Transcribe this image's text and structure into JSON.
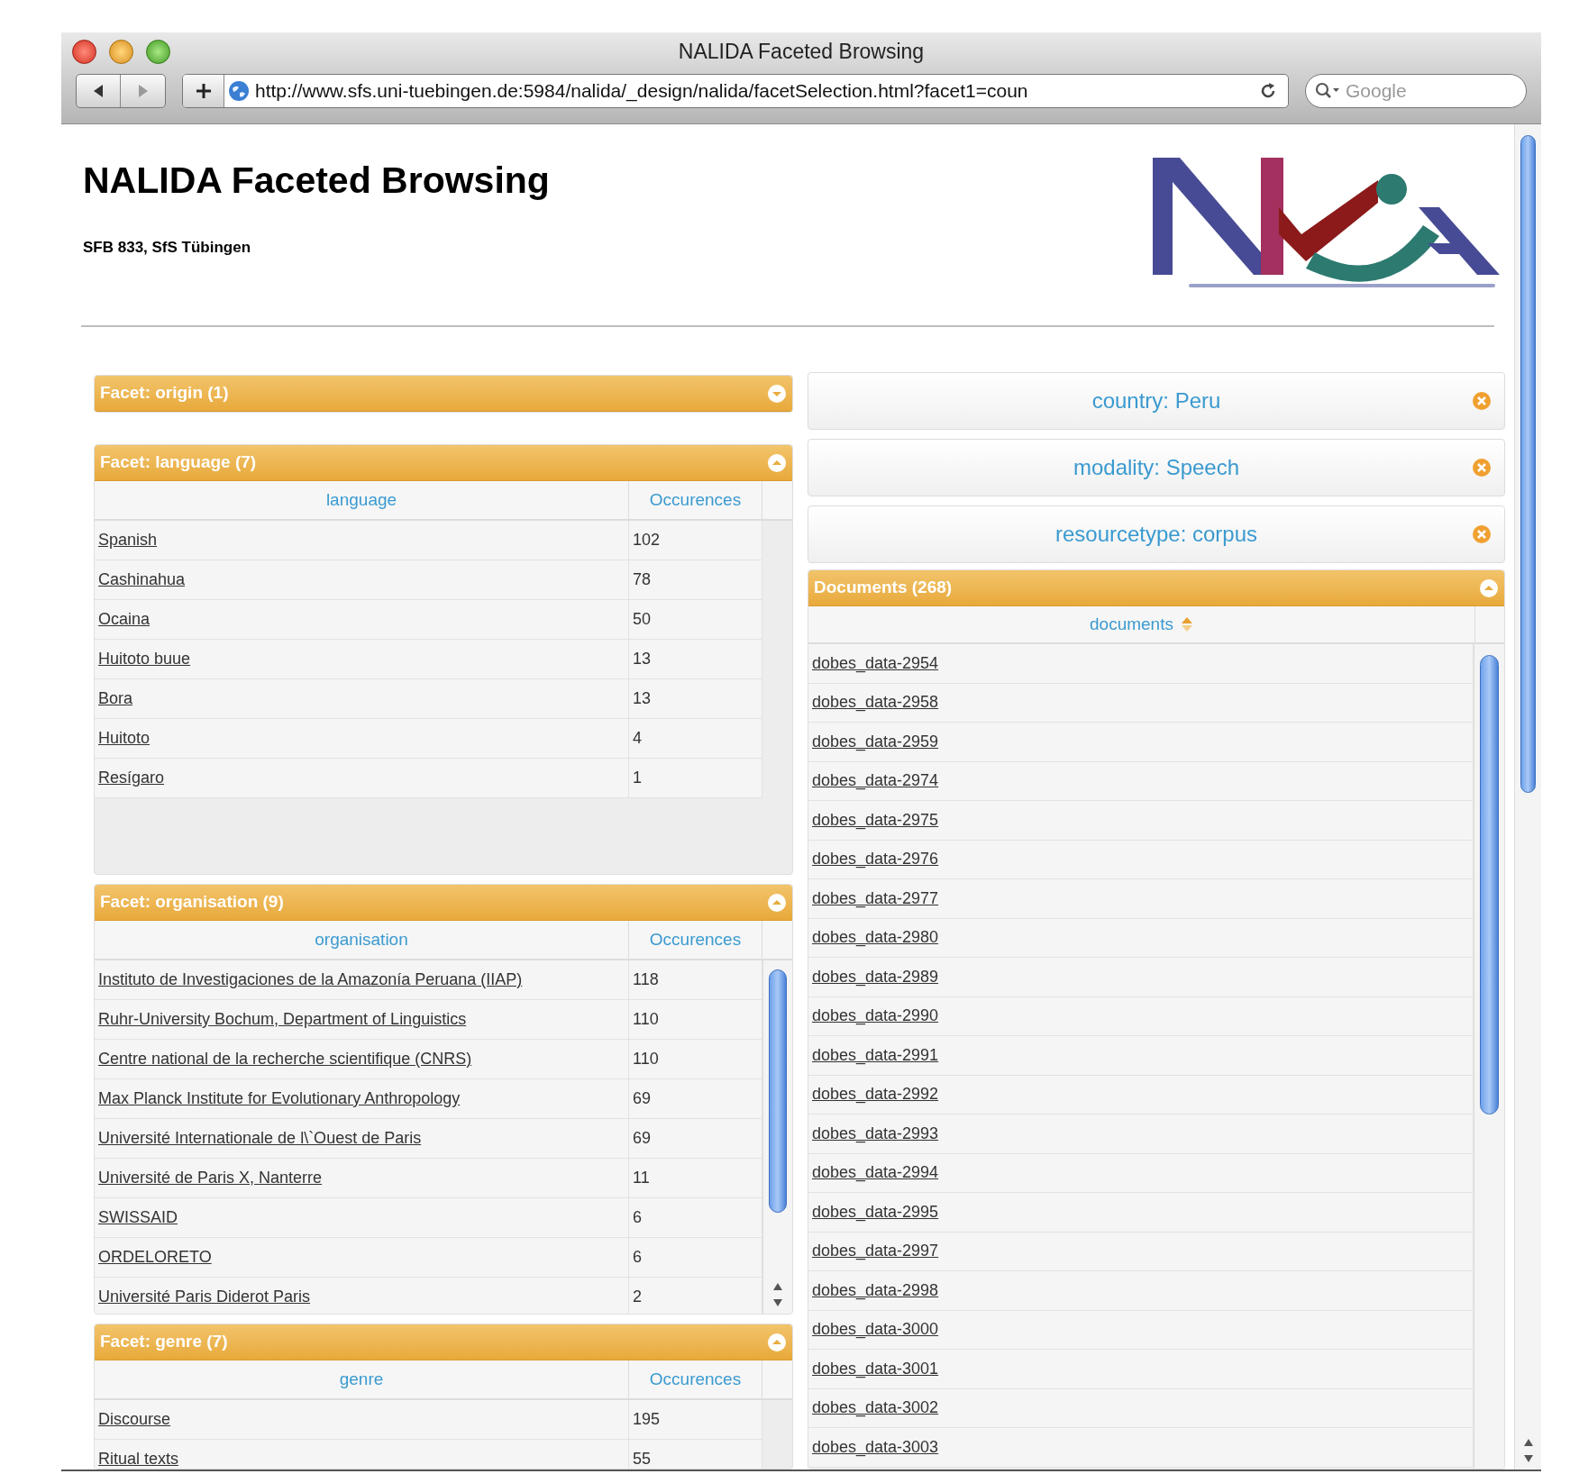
{
  "window": {
    "title": "NALIDA Faceted Browsing",
    "url": "http://www.sfs.uni-tuebingen.de:5984/nalida/_design/nalida/facetSelection.html?facet1=coun",
    "search_placeholder": "Google"
  },
  "page": {
    "title": "NALIDA Faceted Browsing",
    "subtitle": "SFB 833, SfS Tübingen"
  },
  "facets": [
    {
      "title": "Facet: origin (1)",
      "expanded": false
    },
    {
      "title": "Facet: language (7)",
      "expanded": true,
      "column": "language",
      "count_column": "Occurences",
      "rows": [
        {
          "label": "Spanish",
          "count": "102"
        },
        {
          "label": "Cashinahua",
          "count": "78"
        },
        {
          "label": "Ocaina",
          "count": "50"
        },
        {
          "label": "Huitoto buue",
          "count": "13"
        },
        {
          "label": "Bora",
          "count": "13"
        },
        {
          "label": "Huitoto",
          "count": "4"
        },
        {
          "label": "Resígaro",
          "count": "1"
        }
      ]
    },
    {
      "title": "Facet: organisation (9)",
      "expanded": true,
      "column": "organisation",
      "count_column": "Occurences",
      "rows": [
        {
          "label": "Instituto de Investigaciones de la Amazonía Peruana (IIAP)",
          "count": "118"
        },
        {
          "label": "Ruhr-University Bochum, Department of Linguistics",
          "count": "110"
        },
        {
          "label": "Centre national de la recherche scientifique (CNRS)",
          "count": "110"
        },
        {
          "label": "Max Planck Institute for Evolutionary Anthropology",
          "count": "69"
        },
        {
          "label": "Université Internationale de l\\`Ouest de Paris",
          "count": "69"
        },
        {
          "label": "Université de Paris X, Nanterre",
          "count": "11"
        },
        {
          "label": "SWISSAID",
          "count": "6"
        },
        {
          "label": "ORDELORETO",
          "count": "6"
        },
        {
          "label": "Université Paris Diderot Paris",
          "count": "2"
        }
      ]
    },
    {
      "title": "Facet: genre (7)",
      "expanded": true,
      "column": "genre",
      "count_column": "Occurences",
      "rows": [
        {
          "label": "Discourse",
          "count": "195"
        },
        {
          "label": "Ritual texts",
          "count": "55"
        }
      ]
    }
  ],
  "filters": [
    {
      "label": "country: Peru"
    },
    {
      "label": "modality: Speech"
    },
    {
      "label": "resourcetype: corpus"
    }
  ],
  "documents": {
    "title": "Documents (268)",
    "expanded": true,
    "column": "documents",
    "rows": [
      "dobes_data-2954",
      "dobes_data-2958",
      "dobes_data-2959",
      "dobes_data-2974",
      "dobes_data-2975",
      "dobes_data-2976",
      "dobes_data-2977",
      "dobes_data-2980",
      "dobes_data-2989",
      "dobes_data-2990",
      "dobes_data-2991",
      "dobes_data-2992",
      "dobes_data-2993",
      "dobes_data-2994",
      "dobes_data-2995",
      "dobes_data-2997",
      "dobes_data-2998",
      "dobes_data-3000",
      "dobes_data-3001",
      "dobes_data-3002",
      "dobes_data-3003"
    ]
  }
}
